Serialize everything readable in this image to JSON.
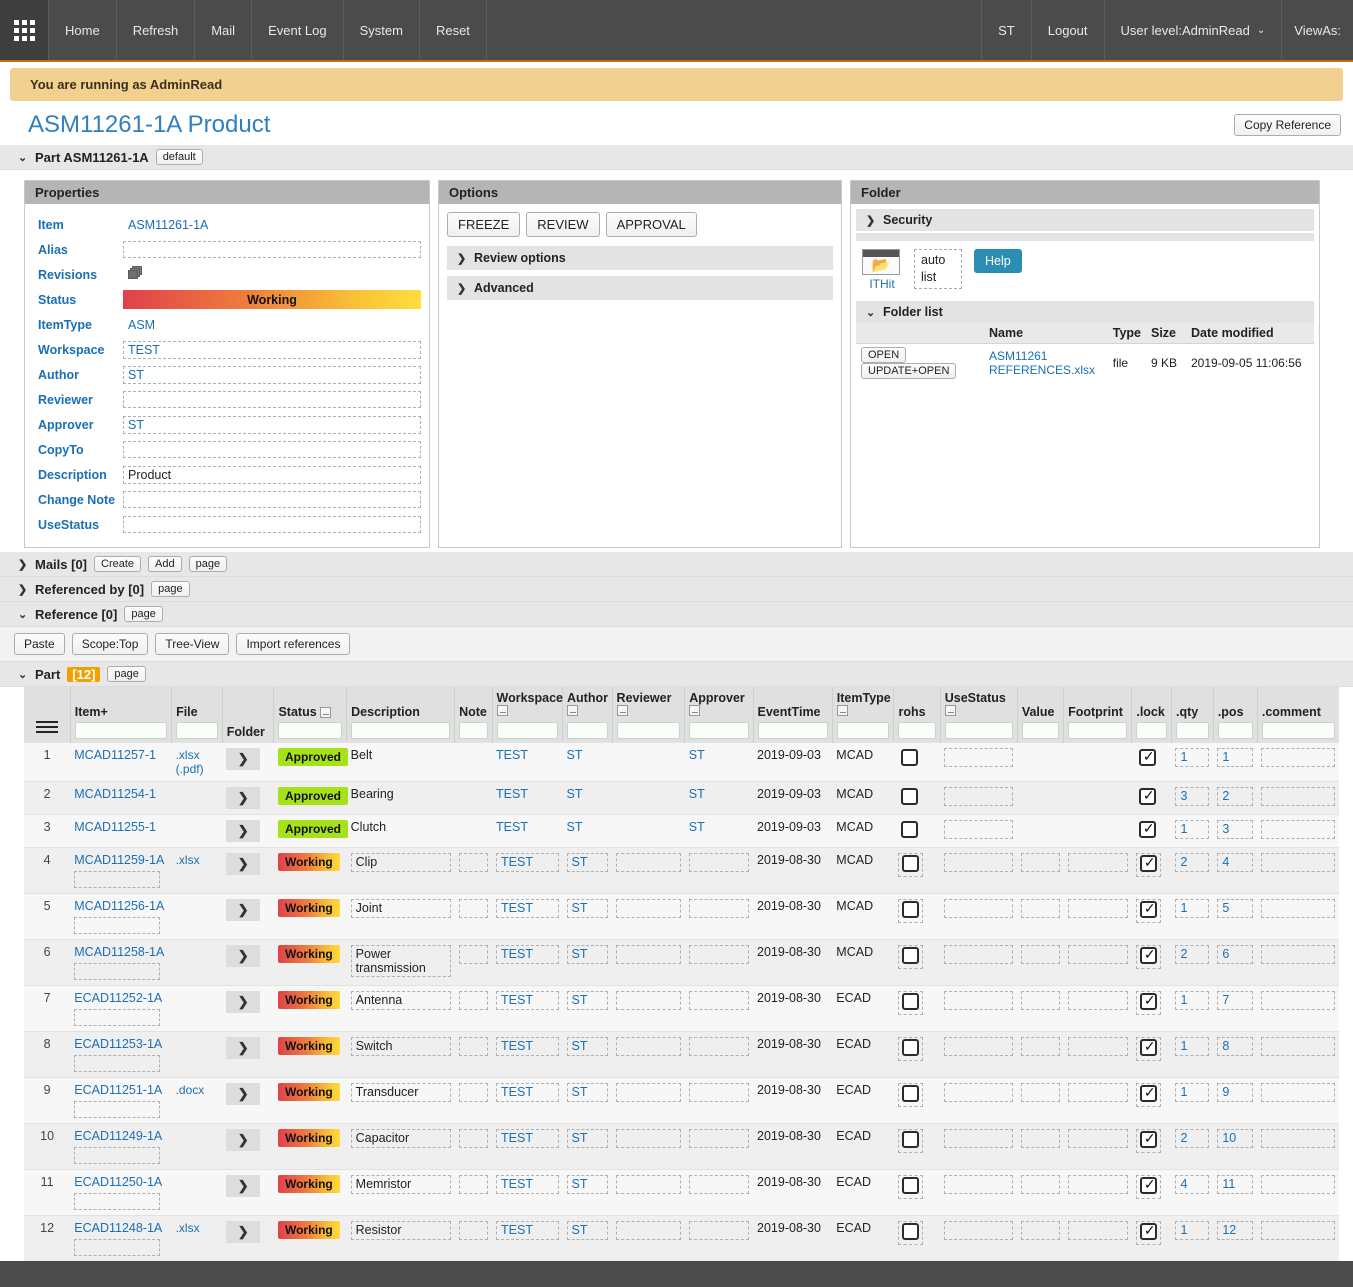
{
  "topnav": {
    "grid_icon": "grid-apps-icon",
    "items": [
      "Home",
      "Refresh",
      "Mail",
      "Event Log",
      "System",
      "Reset"
    ],
    "right_items": [
      "ST",
      "Logout"
    ],
    "user_level": "User level:AdminRead",
    "chevron": "⌄",
    "view_as": "ViewAs:"
  },
  "banner": {
    "text": "You are running as AdminRead"
  },
  "header": {
    "title": "ASM11261-1A Product",
    "copy_reference": "Copy Reference"
  },
  "part_section": {
    "caret": "⌄",
    "label": "Part ASM11261-1A",
    "default_btn": "default"
  },
  "properties": {
    "panel_title": "Properties",
    "rows": [
      {
        "label": "Item",
        "value": "ASM11261-1A",
        "kind": "text"
      },
      {
        "label": "Alias",
        "value": "",
        "kind": "field"
      },
      {
        "label": "Revisions",
        "value": "",
        "kind": "icon"
      },
      {
        "label": "Status",
        "value": "Working",
        "kind": "status"
      },
      {
        "label": "ItemType",
        "value": "ASM",
        "kind": "text"
      },
      {
        "label": "Workspace",
        "value": "TEST",
        "kind": "field"
      },
      {
        "label": "Author",
        "value": "ST",
        "kind": "field"
      },
      {
        "label": "Reviewer",
        "value": "",
        "kind": "field"
      },
      {
        "label": "Approver",
        "value": "ST",
        "kind": "field"
      },
      {
        "label": "CopyTo",
        "value": "",
        "kind": "field"
      },
      {
        "label": "Description",
        "value": "Product",
        "kind": "field-dark"
      },
      {
        "label": "Change Note",
        "value": "",
        "kind": "field"
      },
      {
        "label": "UseStatus",
        "value": "",
        "kind": "field"
      }
    ]
  },
  "options": {
    "panel_title": "Options",
    "buttons": [
      "FREEZE",
      "REVIEW",
      "APPROVAL"
    ],
    "accordions": [
      {
        "caret": "❯",
        "label": "Review options"
      },
      {
        "caret": "❯",
        "label": "Advanced"
      }
    ]
  },
  "folder": {
    "panel_title": "Folder",
    "security": {
      "caret": "❯",
      "label": "Security"
    },
    "folder_icon": "open-folder-icon",
    "folder_link": "ITHit",
    "auto": "auto",
    "list": "list",
    "help": "Help",
    "folder_list": {
      "caret": "⌄",
      "label": "Folder list"
    },
    "columns": [
      "",
      "Name",
      "Type",
      "Size",
      "Date modified"
    ],
    "rows": [
      {
        "open": "OPEN",
        "update_open": "UPDATE+OPEN",
        "name": "ASM11261 REFERENCES.xlsx",
        "type": "file",
        "size": "9 KB",
        "date": "2019-09-05 11:06:56"
      }
    ]
  },
  "sections": {
    "mails": {
      "caret": "❯",
      "label": "Mails [0]",
      "buttons": [
        "Create",
        "Add",
        "page"
      ]
    },
    "referenced_by": {
      "caret": "❯",
      "label": "Referenced by [0]",
      "buttons": [
        "page"
      ]
    },
    "reference": {
      "caret": "⌄",
      "label": "Reference [0]",
      "buttons": [
        "page"
      ]
    },
    "ref_toolbar": [
      "Paste",
      "Scope:Top",
      "Tree-View",
      "Import references"
    ],
    "part": {
      "caret": "⌄",
      "label": "Part",
      "count": "[12]",
      "buttons": [
        "page"
      ]
    }
  },
  "table": {
    "menu_icon": "hamburger-menu-icon",
    "columns": [
      {
        "key": "num",
        "label": "",
        "filter": false,
        "mini": false
      },
      {
        "key": "item",
        "label": "Item+",
        "filter": true,
        "mini": false
      },
      {
        "key": "file",
        "label": "File",
        "filter": true,
        "mini": false
      },
      {
        "key": "folder",
        "label": "Folder",
        "filter": false,
        "mini": false
      },
      {
        "key": "status",
        "label": "Status",
        "filter": true,
        "mini": true
      },
      {
        "key": "description",
        "label": "Description",
        "filter": true,
        "mini": false
      },
      {
        "key": "note",
        "label": "Note",
        "filter": true,
        "mini": false
      },
      {
        "key": "workspace",
        "label": "Workspace",
        "filter": true,
        "mini": true
      },
      {
        "key": "author",
        "label": "Author",
        "filter": true,
        "mini": true
      },
      {
        "key": "reviewer",
        "label": "Reviewer",
        "filter": true,
        "mini": true
      },
      {
        "key": "approver",
        "label": "Approver",
        "filter": true,
        "mini": true
      },
      {
        "key": "eventtime",
        "label": "EventTime",
        "filter": true,
        "mini": false
      },
      {
        "key": "itemtype",
        "label": "ItemType",
        "filter": true,
        "mini": true
      },
      {
        "key": "rohs",
        "label": "rohs",
        "filter": true,
        "mini": false
      },
      {
        "key": "usestatus",
        "label": "UseStatus",
        "filter": true,
        "mini": true
      },
      {
        "key": "value",
        "label": "Value",
        "filter": true,
        "mini": false
      },
      {
        "key": "footprint",
        "label": "Footprint",
        "filter": true,
        "mini": false
      },
      {
        "key": "lock",
        "label": ".lock",
        "filter": true,
        "mini": false
      },
      {
        "key": "qty",
        "label": ".qty",
        "filter": true,
        "mini": false
      },
      {
        "key": "pos",
        "label": ".pos",
        "filter": true,
        "mini": false
      },
      {
        "key": "comment",
        "label": ".comment",
        "filter": true,
        "mini": false
      }
    ],
    "arrow_glyph": "❯",
    "rows": [
      {
        "num": "1",
        "item": "MCAD11257-1",
        "alias": null,
        "file": ".xlsx",
        "file2": "(.pdf)",
        "editable": false,
        "status": "Approved",
        "description": "Belt",
        "note": "",
        "workspace": "TEST",
        "author": "ST",
        "reviewer": "",
        "approver": "ST",
        "eventtime": "2019-09-03",
        "itemtype": "MCAD",
        "rohs": false,
        "usestatus": "",
        "value": "",
        "footprint": "",
        "lock": true,
        "qty": "1",
        "pos": "1",
        "comment": ""
      },
      {
        "num": "2",
        "item": "MCAD11254-1",
        "alias": null,
        "file": "",
        "file2": "",
        "editable": false,
        "status": "Approved",
        "description": "Bearing",
        "note": "",
        "workspace": "TEST",
        "author": "ST",
        "reviewer": "",
        "approver": "ST",
        "eventtime": "2019-09-03",
        "itemtype": "MCAD",
        "rohs": false,
        "usestatus": "",
        "value": "",
        "footprint": "",
        "lock": true,
        "qty": "3",
        "pos": "2",
        "comment": ""
      },
      {
        "num": "3",
        "item": "MCAD11255-1",
        "alias": null,
        "file": "",
        "file2": "",
        "editable": false,
        "status": "Approved",
        "description": "Clutch",
        "note": "",
        "workspace": "TEST",
        "author": "ST",
        "reviewer": "",
        "approver": "ST",
        "eventtime": "2019-09-03",
        "itemtype": "MCAD",
        "rohs": false,
        "usestatus": "",
        "value": "",
        "footprint": "",
        "lock": true,
        "qty": "1",
        "pos": "3",
        "comment": ""
      },
      {
        "num": "4",
        "item": "MCAD11259-1A",
        "alias": "",
        "file": ".xlsx",
        "file2": "",
        "editable": true,
        "status": "Working",
        "description": "Clip",
        "note": "",
        "workspace": "TEST",
        "author": "ST",
        "reviewer": "",
        "approver": "",
        "eventtime": "2019-08-30",
        "itemtype": "MCAD",
        "rohs": false,
        "usestatus": "",
        "value": "",
        "footprint": "",
        "lock": true,
        "qty": "2",
        "pos": "4",
        "comment": ""
      },
      {
        "num": "5",
        "item": "MCAD11256-1A",
        "alias": "",
        "file": "",
        "file2": "",
        "editable": true,
        "status": "Working",
        "description": "Joint",
        "note": "",
        "workspace": "TEST",
        "author": "ST",
        "reviewer": "",
        "approver": "",
        "eventtime": "2019-08-30",
        "itemtype": "MCAD",
        "rohs": false,
        "usestatus": "",
        "value": "",
        "footprint": "",
        "lock": true,
        "qty": "1",
        "pos": "5",
        "comment": ""
      },
      {
        "num": "6",
        "item": "MCAD11258-1A",
        "alias": "",
        "file": "",
        "file2": "",
        "editable": true,
        "status": "Working",
        "description": "Power transmission",
        "note": "",
        "workspace": "TEST",
        "author": "ST",
        "reviewer": "",
        "approver": "",
        "eventtime": "2019-08-30",
        "itemtype": "MCAD",
        "rohs": false,
        "usestatus": "",
        "value": "",
        "footprint": "",
        "lock": true,
        "qty": "2",
        "pos": "6",
        "comment": ""
      },
      {
        "num": "7",
        "item": "ECAD11252-1A",
        "alias": "",
        "file": "",
        "file2": "",
        "editable": true,
        "status": "Working",
        "description": "Antenna",
        "note": "",
        "workspace": "TEST",
        "author": "ST",
        "reviewer": "",
        "approver": "",
        "eventtime": "2019-08-30",
        "itemtype": "ECAD",
        "rohs": false,
        "usestatus": "",
        "value": "",
        "footprint": "",
        "lock": true,
        "qty": "1",
        "pos": "7",
        "comment": ""
      },
      {
        "num": "8",
        "item": "ECAD11253-1A",
        "alias": "",
        "file": "",
        "file2": "",
        "editable": true,
        "status": "Working",
        "description": "Switch",
        "note": "",
        "workspace": "TEST",
        "author": "ST",
        "reviewer": "",
        "approver": "",
        "eventtime": "2019-08-30",
        "itemtype": "ECAD",
        "rohs": false,
        "usestatus": "",
        "value": "",
        "footprint": "",
        "lock": true,
        "qty": "1",
        "pos": "8",
        "comment": ""
      },
      {
        "num": "9",
        "item": "ECAD11251-1A",
        "alias": "",
        "file": ".docx",
        "file2": "",
        "editable": true,
        "status": "Working",
        "description": "Transducer",
        "note": "",
        "workspace": "TEST",
        "author": "ST",
        "reviewer": "",
        "approver": "",
        "eventtime": "2019-08-30",
        "itemtype": "ECAD",
        "rohs": false,
        "usestatus": "",
        "value": "",
        "footprint": "",
        "lock": true,
        "qty": "1",
        "pos": "9",
        "comment": ""
      },
      {
        "num": "10",
        "item": "ECAD11249-1A",
        "alias": "",
        "file": "",
        "file2": "",
        "editable": true,
        "status": "Working",
        "description": "Capacitor",
        "note": "",
        "workspace": "TEST",
        "author": "ST",
        "reviewer": "",
        "approver": "",
        "eventtime": "2019-08-30",
        "itemtype": "ECAD",
        "rohs": false,
        "usestatus": "",
        "value": "",
        "footprint": "",
        "lock": true,
        "qty": "2",
        "pos": "10",
        "comment": ""
      },
      {
        "num": "11",
        "item": "ECAD11250-1A",
        "alias": "",
        "file": "",
        "file2": "",
        "editable": true,
        "status": "Working",
        "description": "Memristor",
        "note": "",
        "workspace": "TEST",
        "author": "ST",
        "reviewer": "",
        "approver": "",
        "eventtime": "2019-08-30",
        "itemtype": "ECAD",
        "rohs": false,
        "usestatus": "",
        "value": "",
        "footprint": "",
        "lock": true,
        "qty": "4",
        "pos": "11",
        "comment": ""
      },
      {
        "num": "12",
        "item": "ECAD11248-1A",
        "alias": "",
        "file": ".xlsx",
        "file2": "",
        "editable": true,
        "status": "Working",
        "description": "Resistor",
        "note": "",
        "workspace": "TEST",
        "author": "ST",
        "reviewer": "",
        "approver": "",
        "eventtime": "2019-08-30",
        "itemtype": "ECAD",
        "rohs": false,
        "usestatus": "",
        "value": "",
        "footprint": "",
        "lock": true,
        "qty": "1",
        "pos": "12",
        "comment": ""
      }
    ]
  },
  "colors": {
    "accent_orange": "#c76a10",
    "link_blue": "#1a6fb5",
    "approved_green": "#a6e219",
    "working_red": "#e0414a",
    "working_yellow": "#ffdc3d",
    "banner_bg": "#f2d190",
    "nav_bg": "#4b4b4b",
    "help_blue": "#2b8cb4"
  }
}
